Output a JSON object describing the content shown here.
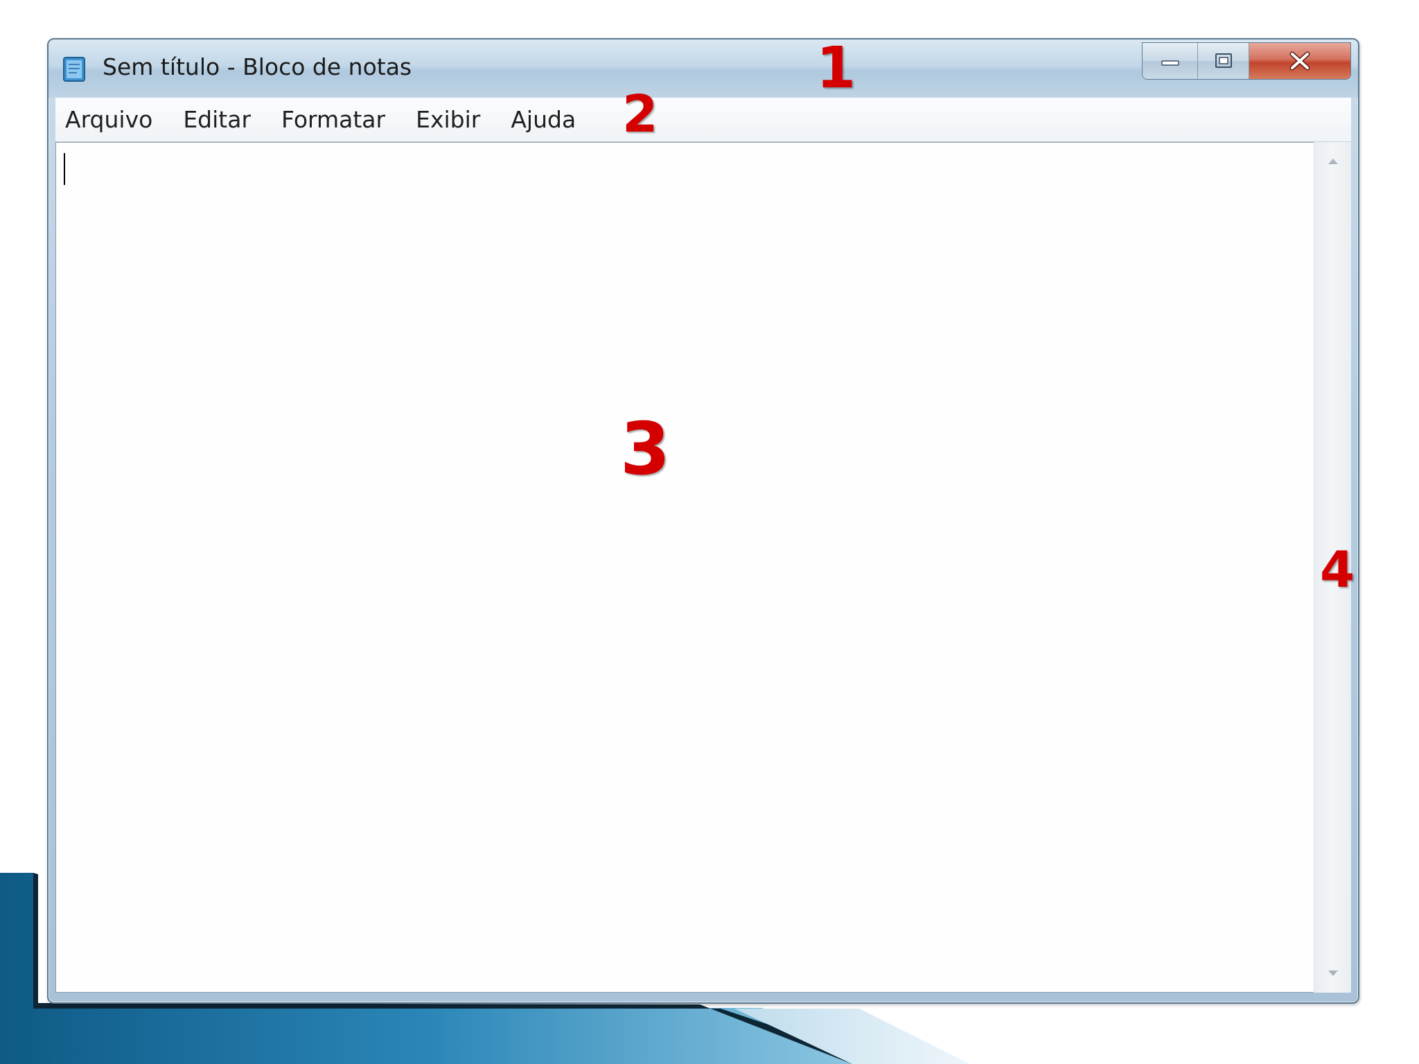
{
  "window": {
    "title": "Sem título - Bloco de notas",
    "controls": {
      "minimize": "minimize-icon",
      "maximize": "maximize-icon",
      "close": "close-icon"
    }
  },
  "menubar": {
    "items": [
      {
        "label": "Arquivo"
      },
      {
        "label": "Editar"
      },
      {
        "label": "Formatar"
      },
      {
        "label": "Exibir"
      },
      {
        "label": "Ajuda"
      }
    ]
  },
  "editor": {
    "content": ""
  },
  "annotations": {
    "one": "1",
    "two": "2",
    "three": "3",
    "four": "4"
  },
  "colors": {
    "annotation": "#d40000",
    "close_button": "#c1442c",
    "slide_accent": "#1b6f9c"
  }
}
